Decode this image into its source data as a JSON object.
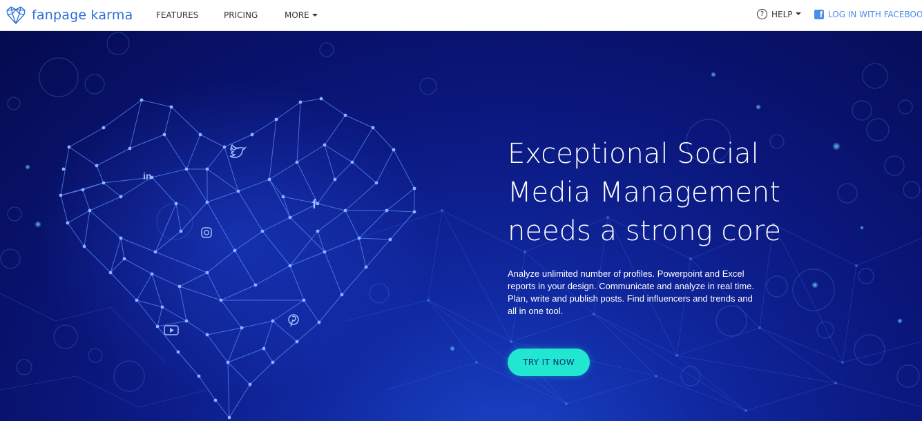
{
  "nav": {
    "logo_text": "fanpage karma",
    "features_label": "FEATURES",
    "pricing_label": "PRICING",
    "more_label": "MORE",
    "help_label": "HELP",
    "help_icon_glyph": "?",
    "login_label": "LOG IN WITH FACEBOOK",
    "facebook_icon_glyph": "f"
  },
  "hero": {
    "headline_lines": [
      "Exceptional Social",
      "Media Management",
      "needs a strong core"
    ],
    "description": "Analyze unlimited number of profiles. Powerpoint and Excel reports in your design. Communicate and analyze in real time. Plan, write and publish posts. Find influencers and trends and all in one tool.",
    "cta_label": "TRY IT NOW",
    "network_icons": [
      "linkedin-icon",
      "twitter-icon",
      "facebook-icon",
      "instagram-icon",
      "youtube-icon",
      "pinterest-icon"
    ]
  },
  "colors": {
    "brand_blue": "#2f6fd6",
    "facebook_blue": "#4a8fe7",
    "hero_dark": "#050b4f",
    "hero_mid": "#10279e",
    "cta_teal": "#21e6d0",
    "network_line": "#5a8bff"
  }
}
